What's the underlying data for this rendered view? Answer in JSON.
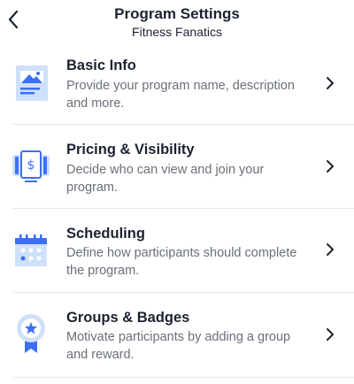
{
  "header": {
    "back_icon": "chevron-left-icon",
    "title": "Program Settings",
    "subtitle": "Fitness Fanatics"
  },
  "settings": {
    "items": [
      {
        "title": "Basic Info",
        "description": "Provide your program name, description and more.",
        "icon": "image-icon"
      },
      {
        "title": "Pricing & Visibility",
        "description": "Decide who can view and join your program.",
        "icon": "dollar-ticket-icon"
      },
      {
        "title": "Scheduling",
        "description": "Define how participants should complete the program.",
        "icon": "calendar-icon"
      },
      {
        "title": "Groups & Badges",
        "description": "Motivate participants by adding a group and reward.",
        "icon": "badge-ribbon-icon"
      }
    ]
  },
  "colors": {
    "accent": "#3b6ff5",
    "icon_light": "#cfe0fb",
    "text_primary": "#1c2230",
    "text_secondary": "#6a6f7b",
    "divider": "#e6e8ec"
  }
}
